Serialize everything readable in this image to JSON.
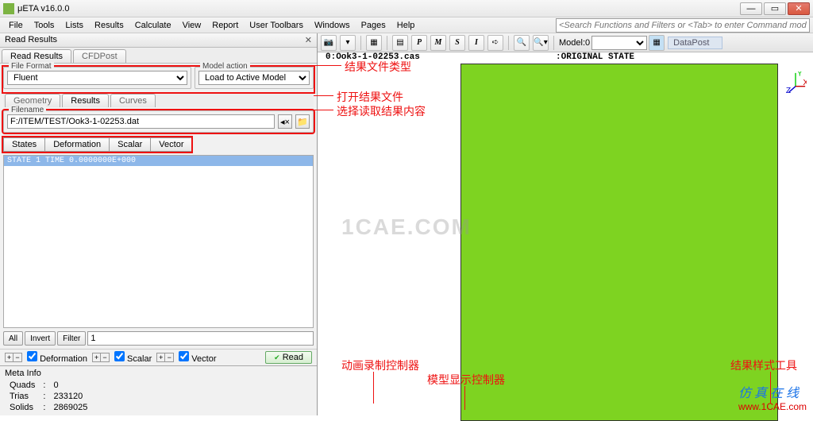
{
  "title": "μETA v16.0.0",
  "menu": [
    "File",
    "Tools",
    "Lists",
    "Results",
    "Calculate",
    "View",
    "Report",
    "User Toolbars",
    "Windows",
    "Pages",
    "Help"
  ],
  "search_placeholder": "<Search Functions and Filters or <Tab> to enter Command mode>",
  "panel": {
    "title": "Read Results",
    "tabs": [
      "Read Results",
      "CFDPost"
    ],
    "file_format_label": "File Format",
    "file_format_value": "Fluent",
    "model_action_label": "Model action",
    "model_action_value": "Load to Active Model",
    "result_tabs": [
      "Geometry",
      "Results",
      "Curves"
    ],
    "filename_label": "Filename",
    "filename_value": "F:/ITEM/TEST/Ook3-1-02253.dat",
    "data_tabs": [
      "States",
      "Deformation",
      "Scalar",
      "Vector"
    ],
    "list_row": "STATE 1        TIME 0.0000000E+000",
    "filter_buttons": [
      "All",
      "Invert",
      "Filter"
    ],
    "filter_value": "1",
    "checks": [
      "Deformation",
      "Scalar",
      "Vector"
    ],
    "read_btn": "Read",
    "meta_label": "Meta Info",
    "meta": [
      [
        "Quads",
        ":",
        "0"
      ],
      [
        "Trias",
        ":",
        "233120"
      ],
      [
        "Solids",
        ":",
        "2869025"
      ]
    ]
  },
  "toolbar": {
    "letters": [
      "P",
      "M",
      "S",
      "I"
    ],
    "model_label": "Model:0",
    "dp": "DataPost"
  },
  "viewport": {
    "file": "0:Ook3-1-02253.cas",
    "state": ":ORIGINAL STATE"
  },
  "annotations": {
    "a1": "结果文件类型",
    "a2": "打开结果文件",
    "a3": "选择读取结果内容",
    "a4": "动画录制控制器",
    "a5": "模型显示控制器",
    "a6": "结果样式工具"
  },
  "watermark": {
    "center": "1CAE.COM",
    "cn": "仿真在线",
    "url": "www.1CAE.com"
  }
}
